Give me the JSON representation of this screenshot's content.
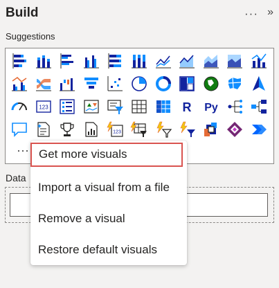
{
  "pane": {
    "title": "Build",
    "more_options": "···",
    "collapse": "»"
  },
  "suggestions": {
    "label": "Suggestions"
  },
  "visuals": [
    {
      "icon": "stacked-bar-chart-icon"
    },
    {
      "icon": "stacked-column-chart-icon"
    },
    {
      "icon": "clustered-bar-chart-icon"
    },
    {
      "icon": "clustered-column-chart-icon"
    },
    {
      "icon": "100-percent-stacked-bar-chart-icon"
    },
    {
      "icon": "100-percent-stacked-column-chart-icon"
    },
    {
      "icon": "line-chart-icon"
    },
    {
      "icon": "area-chart-icon"
    },
    {
      "icon": "stacked-area-chart-icon"
    },
    {
      "icon": "100-percent-stacked-area-chart-icon"
    },
    {
      "icon": "line-and-stacked-column-chart-icon"
    },
    {
      "icon": "line-and-clustered-column-chart-icon"
    },
    {
      "icon": "ribbon-chart-icon"
    },
    {
      "icon": "waterfall-chart-icon"
    },
    {
      "icon": "funnel-chart-icon"
    },
    {
      "icon": "scatter-chart-icon"
    },
    {
      "icon": "pie-chart-icon"
    },
    {
      "icon": "donut-chart-icon"
    },
    {
      "icon": "treemap-icon"
    },
    {
      "icon": "map-icon"
    },
    {
      "icon": "filled-map-icon"
    },
    {
      "icon": "azure-map-icon"
    },
    {
      "icon": "gauge-icon"
    },
    {
      "icon": "card-icon"
    },
    {
      "icon": "multi-row-card-icon"
    },
    {
      "icon": "kpi-icon"
    },
    {
      "icon": "slicer-icon"
    },
    {
      "icon": "table-icon"
    },
    {
      "icon": "matrix-icon"
    },
    {
      "icon": "r-script-visual-icon",
      "glyph": "R"
    },
    {
      "icon": "python-visual-icon",
      "glyph": "Py"
    },
    {
      "icon": "key-influencers-icon"
    },
    {
      "icon": "decomposition-tree-icon"
    },
    {
      "icon": "qa-visual-icon"
    },
    {
      "icon": "smart-narrative-icon"
    },
    {
      "icon": "goals-trophy-icon"
    },
    {
      "icon": "paginated-report-icon"
    },
    {
      "icon": "power-apps-card-icon"
    },
    {
      "icon": "power-automate-filter-icon"
    },
    {
      "icon": "power-automate-funnel-icon"
    },
    {
      "icon": "power-automate-flow-icon"
    },
    {
      "icon": "metrics-visual-icon"
    },
    {
      "icon": "power-apps-icon"
    },
    {
      "icon": "power-automate-icon"
    }
  ],
  "more_visuals": {
    "label": "···"
  },
  "context_menu": {
    "items": [
      {
        "label": "Get more visuals"
      },
      {
        "label": "Import a visual from a file"
      },
      {
        "label": "Remove a visual"
      },
      {
        "label": "Restore default visuals"
      }
    ]
  },
  "data_section": {
    "label": "Data"
  },
  "colors": {
    "accent": "#118dff",
    "navy": "#12239e",
    "orange": "#e66c37",
    "yellow": "#f2c80f",
    "green": "#107c10",
    "menu_focus": "#d9534f"
  }
}
